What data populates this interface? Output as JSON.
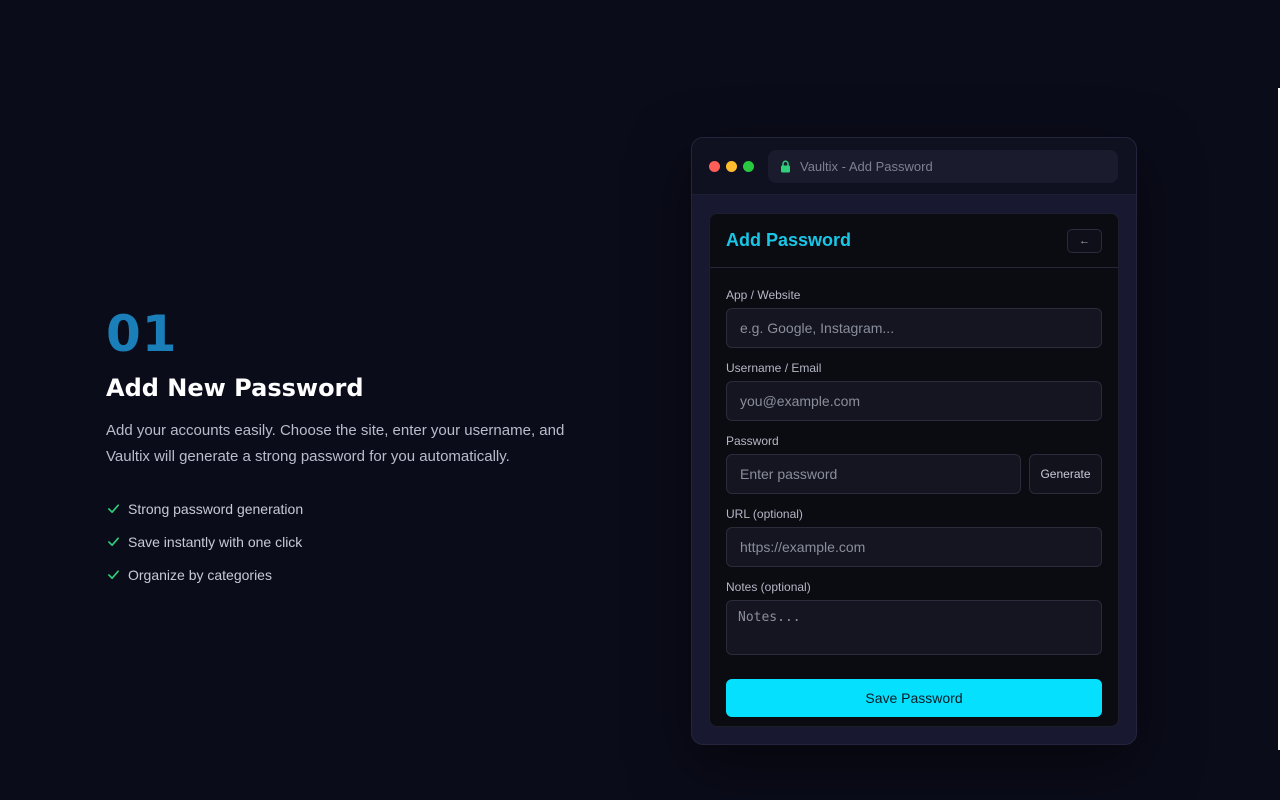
{
  "promo": {
    "step_number": "01",
    "title": "Add New Password",
    "description": "Add your accounts easily. Choose the site, enter your username, and Vaultix will generate a strong password for you automatically.",
    "features": [
      "Strong password generation",
      "Save instantly with one click",
      "Organize by categories"
    ]
  },
  "window": {
    "address_text": "Vaultix - Add Password",
    "card_title": "Add Password",
    "back_label": "←",
    "fields": {
      "app": {
        "label": "App / Website",
        "placeholder": "e.g. Google, Instagram..."
      },
      "username": {
        "label": "Username / Email",
        "placeholder": "you@example.com"
      },
      "password": {
        "label": "Password",
        "placeholder": "Enter password",
        "generate_label": "Generate"
      },
      "url": {
        "label": "URL (optional)",
        "placeholder": "https://example.com"
      },
      "notes": {
        "label": "Notes (optional)",
        "placeholder": "Notes..."
      }
    },
    "save_label": "Save Password"
  },
  "colors": {
    "background": "#0b0c1a",
    "accent": "#05e0ff",
    "step_number": "#1a7fb8",
    "check": "#2fd07a"
  },
  "icons": [
    "check-icon",
    "lock-icon",
    "back-arrow-icon"
  ]
}
